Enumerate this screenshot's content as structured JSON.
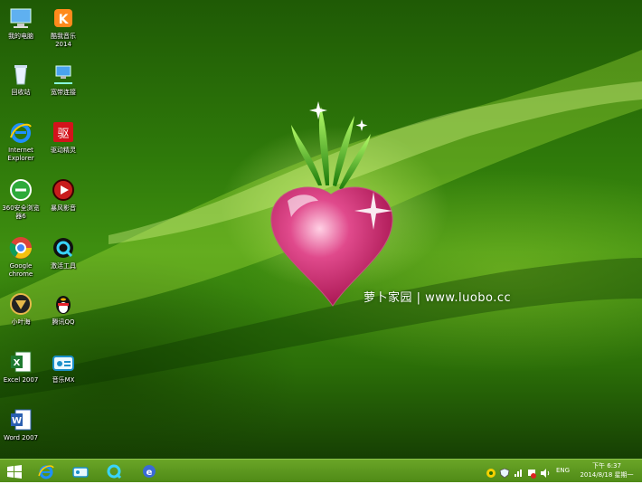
{
  "desktop": {
    "icons": [
      {
        "label": "我的电脑"
      },
      {
        "label": "酷我音乐\n2014"
      },
      {
        "label": "回收站"
      },
      {
        "label": "宽带连接"
      },
      {
        "label": "Internet\nExplorer"
      },
      {
        "label": "驱动精灵"
      },
      {
        "label": "360安全浏览\n器6"
      },
      {
        "label": "暴风影音"
      },
      {
        "label": "Google\nchrome"
      },
      {
        "label": "激活工具"
      },
      {
        "label": "小叶海"
      },
      {
        "label": "腾讯QQ"
      },
      {
        "label": "Excel 2007"
      },
      {
        "label": "音乐MX"
      },
      {
        "label": "Word 2007"
      }
    ],
    "brand_text": "萝卜家园 | www.luobo.cc"
  },
  "taskbar": {
    "language": "ENG",
    "clock_time": "下午 6:37",
    "clock_date": "2014/8/18 星期一"
  }
}
